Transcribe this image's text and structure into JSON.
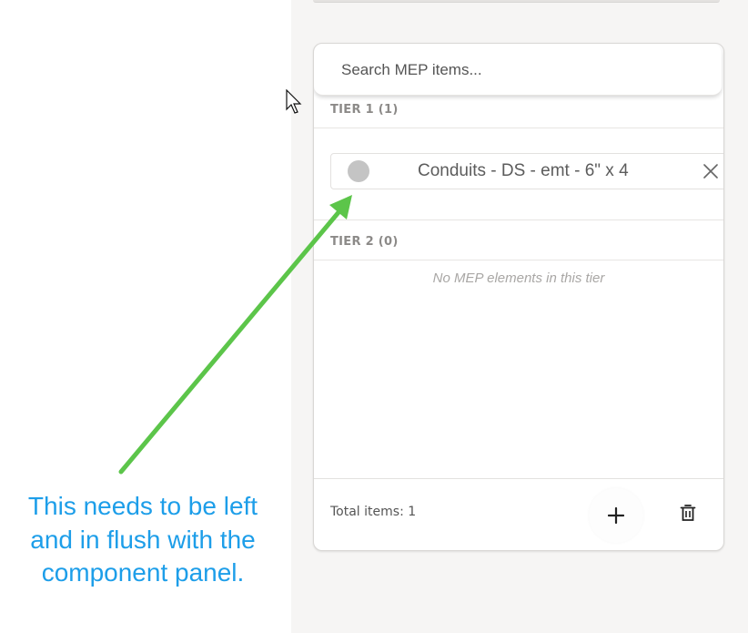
{
  "search": {
    "placeholder": "Search MEP items..."
  },
  "tiers": [
    {
      "header": "TIER 1 (1)",
      "items": [
        {
          "label": "Conduits - DS - emt - 6\" x 4",
          "color": "#c4c4c4"
        }
      ]
    },
    {
      "header": "TIER 2 (0)",
      "empty_message": "No MEP elements in this tier"
    }
  ],
  "footer": {
    "total_items": "Total items: 1"
  },
  "annotation": {
    "lines": [
      "This needs to be left",
      "and in flush with the",
      "component panel."
    ],
    "arrow_color": "#5cc54a",
    "text_color": "#1d9ee9"
  },
  "icons": [
    "cursor-icon",
    "close-icon",
    "plus-icon",
    "trash-icon"
  ]
}
